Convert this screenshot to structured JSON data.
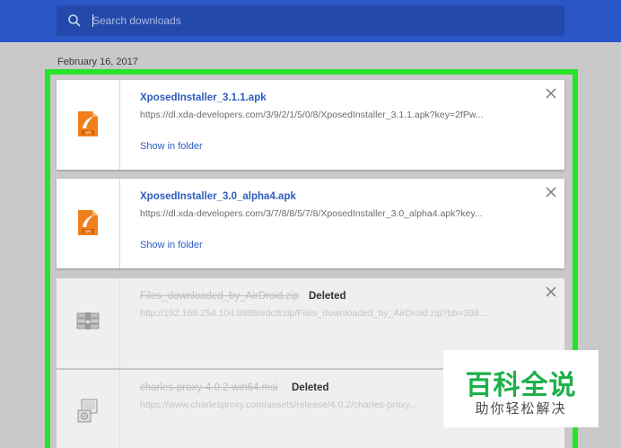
{
  "search": {
    "placeholder": "Search downloads"
  },
  "date_header": "February 16, 2017",
  "downloads": [
    {
      "name": "XposedInstaller_3.1.1.apk",
      "url": "https://dl.xda-developers.com/3/9/2/1/5/0/8/XposedInstaller_3.1.1.apk?key=2fPw...",
      "action": "Show in folder",
      "file_icon": "apk-file-icon"
    },
    {
      "name": "XposedInstaller_3.0_alpha4.apk",
      "url": "https://dl.xda-developers.com/3/7/8/8/5/7/8/XposedInstaller_3.0_alpha4.apk?key...",
      "action": "Show in folder",
      "file_icon": "apk-file-icon"
    },
    {
      "name": "Files_downloaded_by_AirDroid.zip",
      "status": "Deleted",
      "url": "http://192.168.254.104:8888/sdctl/zip/Files_downloaded_by_AirDroid.zip?bb=398...",
      "file_icon": "zip-archive-icon"
    },
    {
      "name": "charles-proxy-4.0.2-win64.msi",
      "status": "Deleted",
      "url": "https://www.charlesproxy.com/assets/release/4.0.2/charles-proxy...",
      "file_icon": "msi-installer-icon"
    }
  ],
  "watermark": {
    "title": "百科全说",
    "subtitle": "助你轻松解决"
  },
  "colors": {
    "header": "#2b56c6",
    "highlight": "#27e32a",
    "link": "#2d5dbf",
    "watermark_green": "#1db04a"
  }
}
